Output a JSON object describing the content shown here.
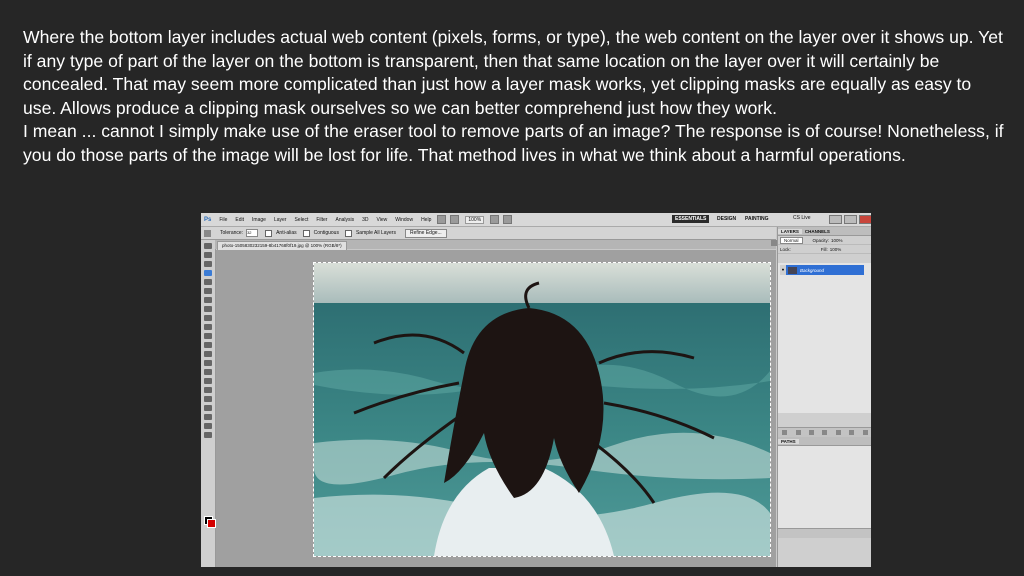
{
  "article": {
    "paragraph1": "Where the bottom layer includes actual web content (pixels, forms, or type), the web content on the layer over it shows up. Yet if any type of part of the layer on the bottom is transparent, then that same location on the layer over it will certainly be concealed. That may seem more complicated than just how a layer mask works, yet clipping masks are equally as easy to use. Allows produce a clipping mask ourselves so we can better comprehend just how they work.",
    "paragraph2": "I mean ... cannot I simply make use of the eraser tool to remove parts of an image? The response is of course! Nonetheless, if you do those parts of the image will be lost for life. That method lives in what we think about a harmful operations."
  },
  "screenshot": {
    "app_logo": "Ps",
    "menu": [
      "File",
      "Edit",
      "Image",
      "Layer",
      "Select",
      "Filter",
      "Analysis",
      "3D",
      "View",
      "Window",
      "Help"
    ],
    "zoom": "100%",
    "workspaces": {
      "essentials": "ESSENTIALS",
      "design": "DESIGN",
      "painting": "PAINTING"
    },
    "cslive": "CS Live",
    "options": {
      "tolerance_label": "Tolerance:",
      "tolerance_value": "32",
      "antialias": "Anti-alias",
      "contiguous": "Contiguous",
      "sample_all": "Sample All Layers",
      "refine_edge": "Refine Edge..."
    },
    "doc_tab": "photo-1505830232159-8b41768f0f19.jpg @ 100% (RGB/8*)",
    "layers_panel": {
      "tabs": [
        "LAYERS",
        "CHANNELS"
      ],
      "blend_mode": "Normal",
      "opacity_label": "Opacity:",
      "opacity_value": "100%",
      "lock_label": "Lock:",
      "fill_label": "Fill:",
      "fill_value": "100%",
      "layer_name": "Background"
    },
    "paths_panel": {
      "title": "PATHS"
    }
  },
  "colors": {
    "page_bg": "#262626",
    "text": "#ffffff",
    "ps_ui": "#c9c9c9",
    "selected_layer": "#2f6fd4",
    "sea": "#2e6f73"
  }
}
